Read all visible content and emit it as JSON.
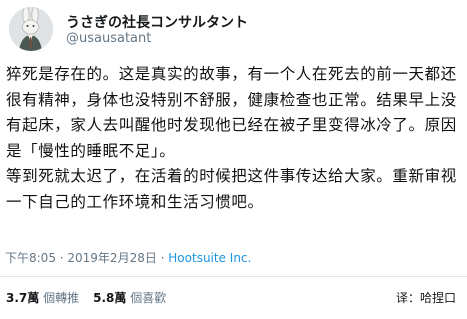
{
  "user": {
    "display_name": "うさぎの社長コンサルタント",
    "handle": "@usausatant",
    "avatar_icon": "rabbit-avatar-icon"
  },
  "tweet": {
    "paragraphs": [
      "猝死是存在的。这是真实的故事，有一个人在死去的前一天都还很有精神，身体也没特别不舒服，健康检查也正常。结果早上没有起床，家人去叫醒他时发现他已经在被子里变得冰冷了。原因是「慢性的睡眠不足」。",
      "等到死就太迟了，在活着的时候把这件事传达给大家。重新审视一下自己的工作环境和生活习惯吧。"
    ],
    "timestamp": "下午8:05 · 2019年2月28日 · ",
    "via": "Hootsuite Inc."
  },
  "stats": {
    "retweets_count": "3.7萬",
    "retweets_label": "個轉推",
    "likes_count": "5.8萬",
    "likes_label": "個喜歡"
  },
  "footer": {
    "translate_label": "译：哈捏口"
  },
  "colors": {
    "secondary_text": "#657786",
    "link": "#1b95e0",
    "divider": "#e1e8ed"
  }
}
